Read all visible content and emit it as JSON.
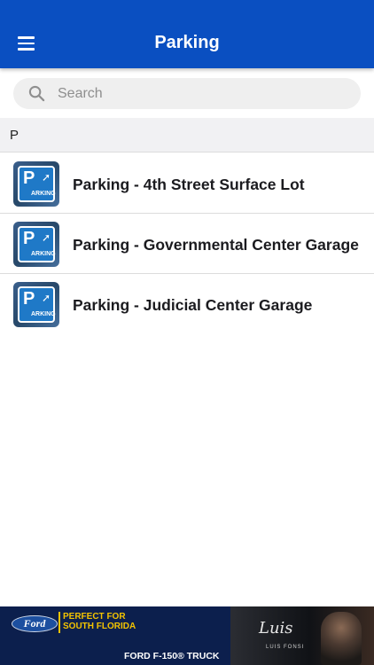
{
  "header": {
    "title": "Parking",
    "menu_icon": "hamburger-menu-icon",
    "background_color": "#0a4fc1"
  },
  "search": {
    "placeholder": "Search",
    "value": "",
    "icon": "search-icon"
  },
  "section": {
    "letter": "P"
  },
  "items": [
    {
      "label": "Parking - 4th Street Surface Lot",
      "icon_letter": "P",
      "icon_word": "ARKING"
    },
    {
      "label": "Parking - Governmental Center Garage",
      "icon_letter": "P",
      "icon_word": "ARKING"
    },
    {
      "label": "Parking - Judicial Center Garage",
      "icon_letter": "P",
      "icon_word": "ARKING"
    }
  ],
  "ad": {
    "brand": "Ford",
    "headline_line1": "PERFECT FOR",
    "headline_line2": "SOUTH FLORIDA",
    "subline": "FORD F-150® TRUCK",
    "signature": "Luis",
    "signature_caption": "LUIS FONSI",
    "accent_color": "#f3c300"
  }
}
